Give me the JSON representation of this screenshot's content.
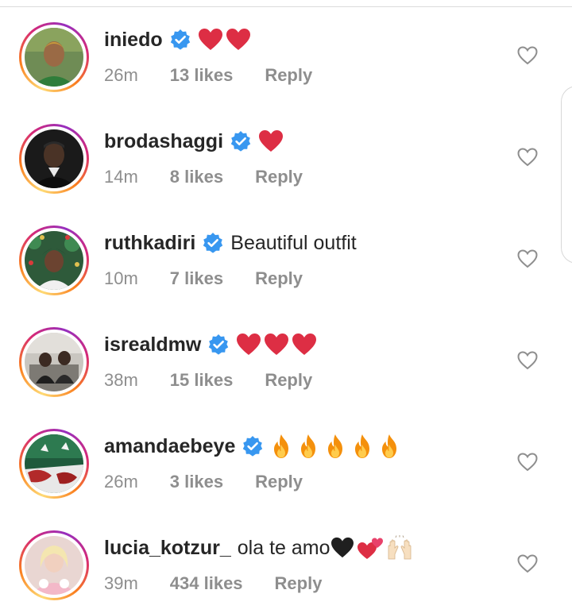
{
  "comments": [
    {
      "username": "iniedo",
      "text": "",
      "emojis": [
        "red-heart",
        "red-heart"
      ],
      "time": "26m",
      "likes": "13 likes",
      "reply": "Reply"
    },
    {
      "username": "brodashaggi",
      "text": "",
      "emojis": [
        "red-heart"
      ],
      "time": "14m",
      "likes": "8 likes",
      "reply": "Reply"
    },
    {
      "username": "ruthkadiri",
      "text": "Beautiful outfit",
      "emojis": [],
      "time": "10m",
      "likes": "7 likes",
      "reply": "Reply"
    },
    {
      "username": "isrealdmw",
      "text": "",
      "emojis": [
        "red-heart",
        "red-heart",
        "red-heart"
      ],
      "time": "38m",
      "likes": "15 likes",
      "reply": "Reply"
    },
    {
      "username": "amandaebeye",
      "text": "",
      "emojis": [
        "fire",
        "fire",
        "fire",
        "fire",
        "fire"
      ],
      "time": "26m",
      "likes": "3 likes",
      "reply": "Reply"
    },
    {
      "username": "lucia_kotzur_",
      "text": "ola te amo",
      "emojis": [
        "black-heart",
        "two-hearts",
        "raising-hands"
      ],
      "time": "39m",
      "likes": "434 likes",
      "reply": "Reply"
    }
  ],
  "icons": {
    "verified": "verified-badge-icon",
    "like": "heart-outline-icon"
  },
  "colors": {
    "username": "#262626",
    "meta": "#8e8e8e",
    "verified": "#3897f0",
    "ring_start": "#feda75",
    "ring_end": "#962fbf"
  }
}
